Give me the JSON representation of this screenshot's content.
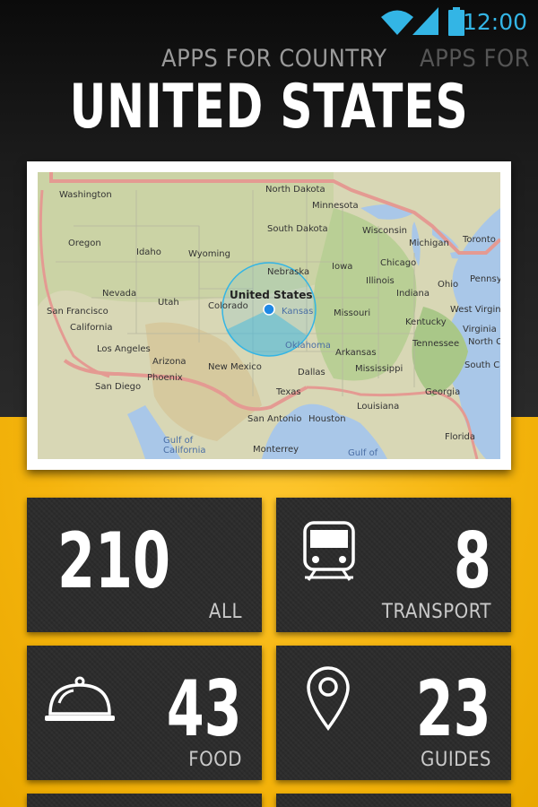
{
  "status_bar": {
    "time": "12:00"
  },
  "header": {
    "subtitle": "APPS FOR COUNTRY",
    "subtitle_next": "APPS FOR C",
    "title": "UNITED STATES"
  },
  "map": {
    "location_label": "United States",
    "labels": [
      "Washington",
      "North Dakota",
      "Minnesota",
      "South Dakota",
      "Wisconsin",
      "Michigan",
      "Toronto",
      "Oregon",
      "Idaho",
      "Wyoming",
      "Nebraska",
      "Iowa",
      "Chicago",
      "Ohio",
      "Pennsylv",
      "Nevada",
      "Utah",
      "Colorado",
      "Kansas",
      "Illinois",
      "Indiana",
      "West Virginia",
      "San Francisco",
      "California",
      "Missouri",
      "Kentucky",
      "Virginia",
      "Los Angeles",
      "Arizona",
      "Oklahoma",
      "Tennessee",
      "North Carolina",
      "Arkansas",
      "San Diego",
      "Phoenix",
      "New Mexico",
      "Dallas",
      "Mississippi",
      "South Carolina",
      "Texas",
      "Louisiana",
      "Georgia",
      "San Antonio",
      "Houston",
      "Florida",
      "Gulf of California",
      "Monterrey",
      "Gulf of"
    ]
  },
  "tiles": [
    {
      "count": "210",
      "label": "ALL",
      "icon": "none"
    },
    {
      "count": "8",
      "label": "TRANSPORT",
      "icon": "train-icon"
    },
    {
      "count": "43",
      "label": "FOOD",
      "icon": "food-cloche-icon"
    },
    {
      "count": "23",
      "label": "GUIDES",
      "icon": "map-pin-icon"
    }
  ],
  "colors": {
    "accent_blue": "#33b5e5",
    "yellow": "#f5b40d",
    "tile": "#2c2c2c"
  }
}
